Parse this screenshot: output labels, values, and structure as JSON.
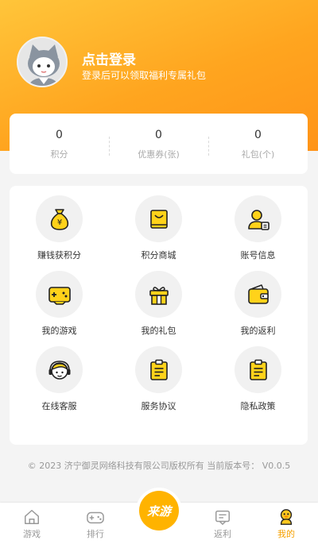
{
  "profile": {
    "login_title": "点击登录",
    "login_subtitle": "登录后可以领取福利专属礼包"
  },
  "stats": [
    {
      "value": "0",
      "label": "积分"
    },
    {
      "value": "0",
      "label": "优惠券(张)"
    },
    {
      "value": "0",
      "label": "礼包(个)"
    }
  ],
  "menu": [
    {
      "label": "赚钱获积分",
      "icon": "money-bag-icon"
    },
    {
      "label": "积分商城",
      "icon": "shopping-bag-icon"
    },
    {
      "label": "账号信息",
      "icon": "user-card-icon"
    },
    {
      "label": "我的游戏",
      "icon": "gamepad-icon"
    },
    {
      "label": "我的礼包",
      "icon": "gift-icon"
    },
    {
      "label": "我的返利",
      "icon": "wallet-icon"
    },
    {
      "label": "在线客服",
      "icon": "headset-icon"
    },
    {
      "label": "服务协议",
      "icon": "clipboard-icon"
    },
    {
      "label": "隐私政策",
      "icon": "clipboard-icon"
    }
  ],
  "footer": {
    "copyright": "© 2023 济宁御灵网络科技有限公司版权所有 当前版本号： V0.0.5"
  },
  "tabbar": {
    "tabs": [
      {
        "label": "游戏",
        "icon": "home-icon"
      },
      {
        "label": "排行",
        "icon": "gamepad-icon"
      },
      {
        "label": "返利",
        "icon": "message-icon"
      },
      {
        "label": "我的",
        "icon": "duck-icon"
      }
    ],
    "center_label": "来游",
    "active": "我的"
  },
  "colors": {
    "accent": "#ffb300",
    "header_gradient_start": "#ffc53a",
    "header_gradient_end": "#ff9418",
    "icon_fill": "#ffd21a"
  }
}
